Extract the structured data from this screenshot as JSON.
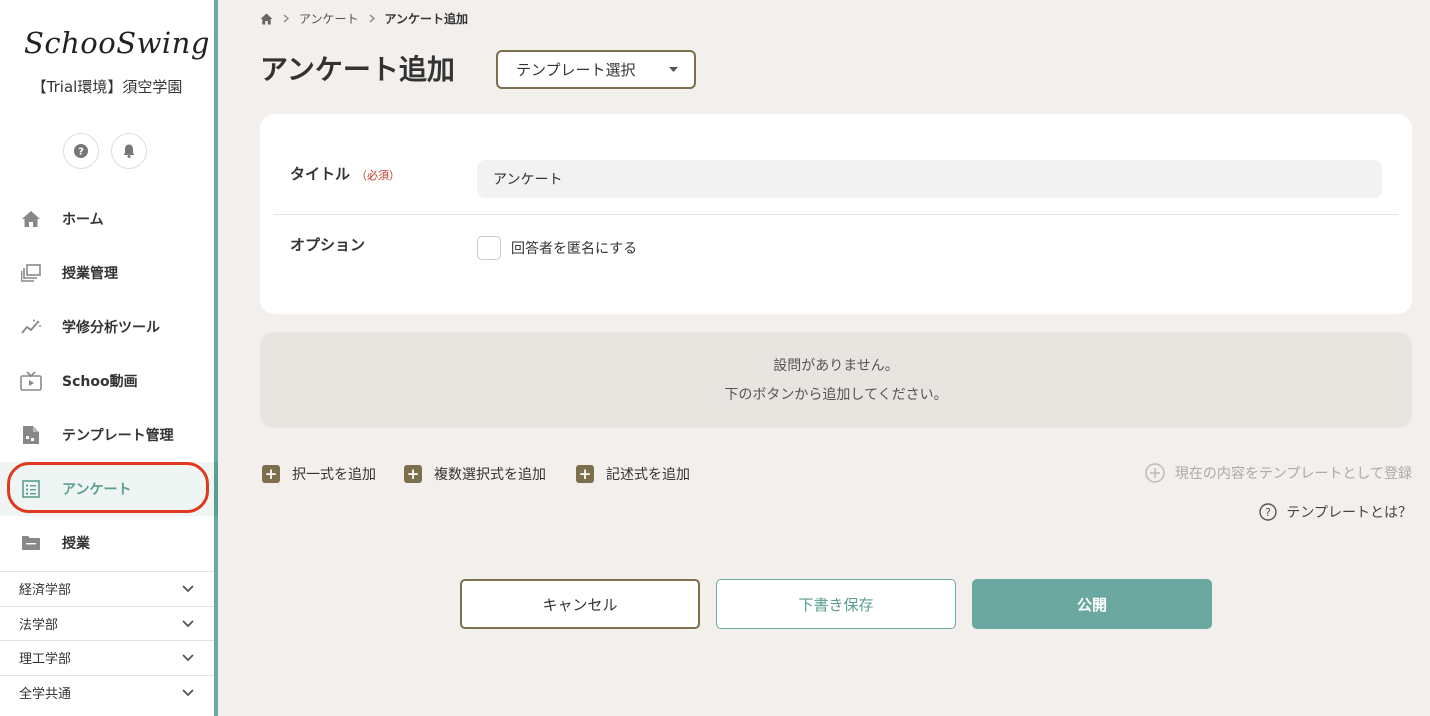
{
  "app": {
    "logo": "SchooSwing",
    "org": "【Trial環境】須空学園"
  },
  "header_icons": {
    "help": "help-icon",
    "bell": "bell-icon"
  },
  "nav": [
    {
      "label": "ホーム",
      "icon": "home-icon"
    },
    {
      "label": "授業管理",
      "icon": "class-management-icon"
    },
    {
      "label": "学修分析ツール",
      "icon": "analytics-icon"
    },
    {
      "label": "Schoo動画",
      "icon": "video-icon"
    },
    {
      "label": "テンプレート管理",
      "icon": "template-icon"
    },
    {
      "label": "アンケート",
      "icon": "survey-icon",
      "active": true
    },
    {
      "label": "授業",
      "icon": "folder-icon"
    }
  ],
  "departments": [
    "経済学部",
    "法学部",
    "理工学部",
    "全学共通"
  ],
  "breadcrumb": [
    "アンケート",
    "アンケート追加"
  ],
  "page": {
    "title": "アンケート追加",
    "template_select": "テンプレート選択"
  },
  "form": {
    "title_label": "タイトル",
    "required": "（必須）",
    "title_value": "アンケート",
    "option_label": "オプション",
    "anonymous_label": "回答者を匿名にする"
  },
  "empty": {
    "line1": "設問がありません。",
    "line2": "下のボタンから追加してください。"
  },
  "add_buttons": [
    "択一式を追加",
    "複数選択式を追加",
    "記述式を追加"
  ],
  "register_template": "現在の内容をテンプレートとして登録",
  "what_template": "テンプレートとは？",
  "actions": {
    "cancel": "キャンセル",
    "draft": "下書き保存",
    "publish": "公開"
  },
  "colors": {
    "accent": "#6aa8a0",
    "brown": "#7b6f4c",
    "highlight": "#e0391e",
    "background": "#f2efec"
  }
}
